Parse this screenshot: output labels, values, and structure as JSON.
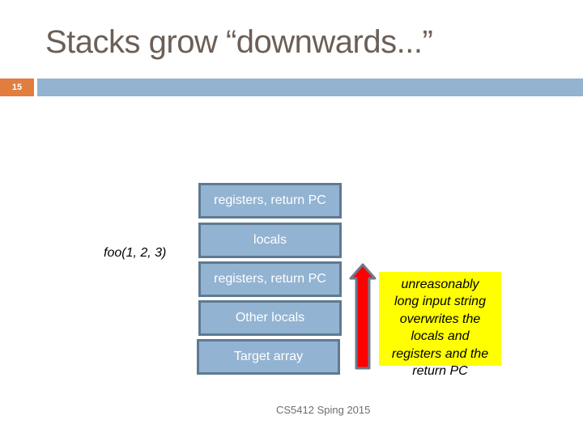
{
  "slide": {
    "title": "Stacks grow “downwards...”",
    "number": "15",
    "footer": "CS5412 Sping 2015"
  },
  "stack": {
    "call_label": "foo(1, 2, 3)",
    "frames": [
      {
        "label": "registers, return PC"
      },
      {
        "label": "locals"
      },
      {
        "label": "registers, return PC"
      },
      {
        "label": "Other locals"
      },
      {
        "label": "Target array"
      }
    ]
  },
  "annotation": {
    "lines": [
      "unreasonably",
      "long input string",
      "overwrites the",
      "locals and",
      "registers and the",
      "return PC"
    ]
  },
  "colors": {
    "accent_orange": "#e07d3f",
    "header_blue": "#93b3d1",
    "frame_fill": "#93b3d2",
    "frame_border": "#5f7a92",
    "arrow_fill": "#ff0000",
    "arrow_outline": "#6b7a8c",
    "note_highlight": "#ffff00"
  }
}
